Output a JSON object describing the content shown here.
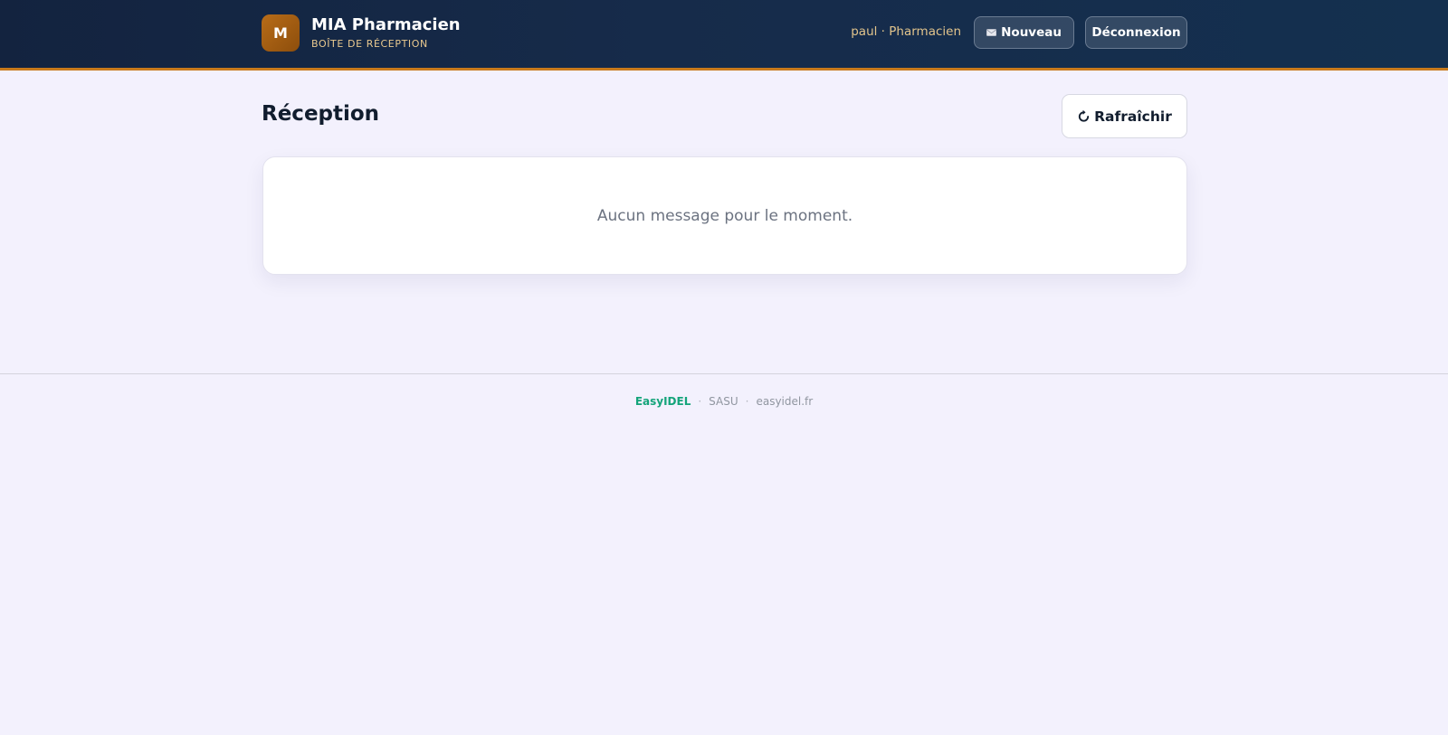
{
  "header": {
    "logo_letter": "M",
    "app_title": "MIA Pharmacien",
    "app_subtitle": "BOÎTE DE RÉCEPTION",
    "user_label": "paul · Pharmacien",
    "new_button_label": "Nouveau",
    "logout_button_label": "Déconnexion",
    "new_button_icon": "envelope-icon"
  },
  "main": {
    "page_title": "Réception",
    "refresh_button_label": "Rafraîchir",
    "refresh_icon": "refresh-icon",
    "empty_message": "Aucun message pour le moment."
  },
  "footer": {
    "brand": "EasyIDEL",
    "separator": "·",
    "company_type": "SASU",
    "website": "easyidel.fr"
  },
  "colors": {
    "header_bg": "#13233f",
    "accent_orange": "#c87a1c",
    "logo_bg": "#a9631a",
    "user_text": "#e2c48c",
    "page_bg": "#f3f1fd",
    "footer_brand": "#14a47a"
  }
}
